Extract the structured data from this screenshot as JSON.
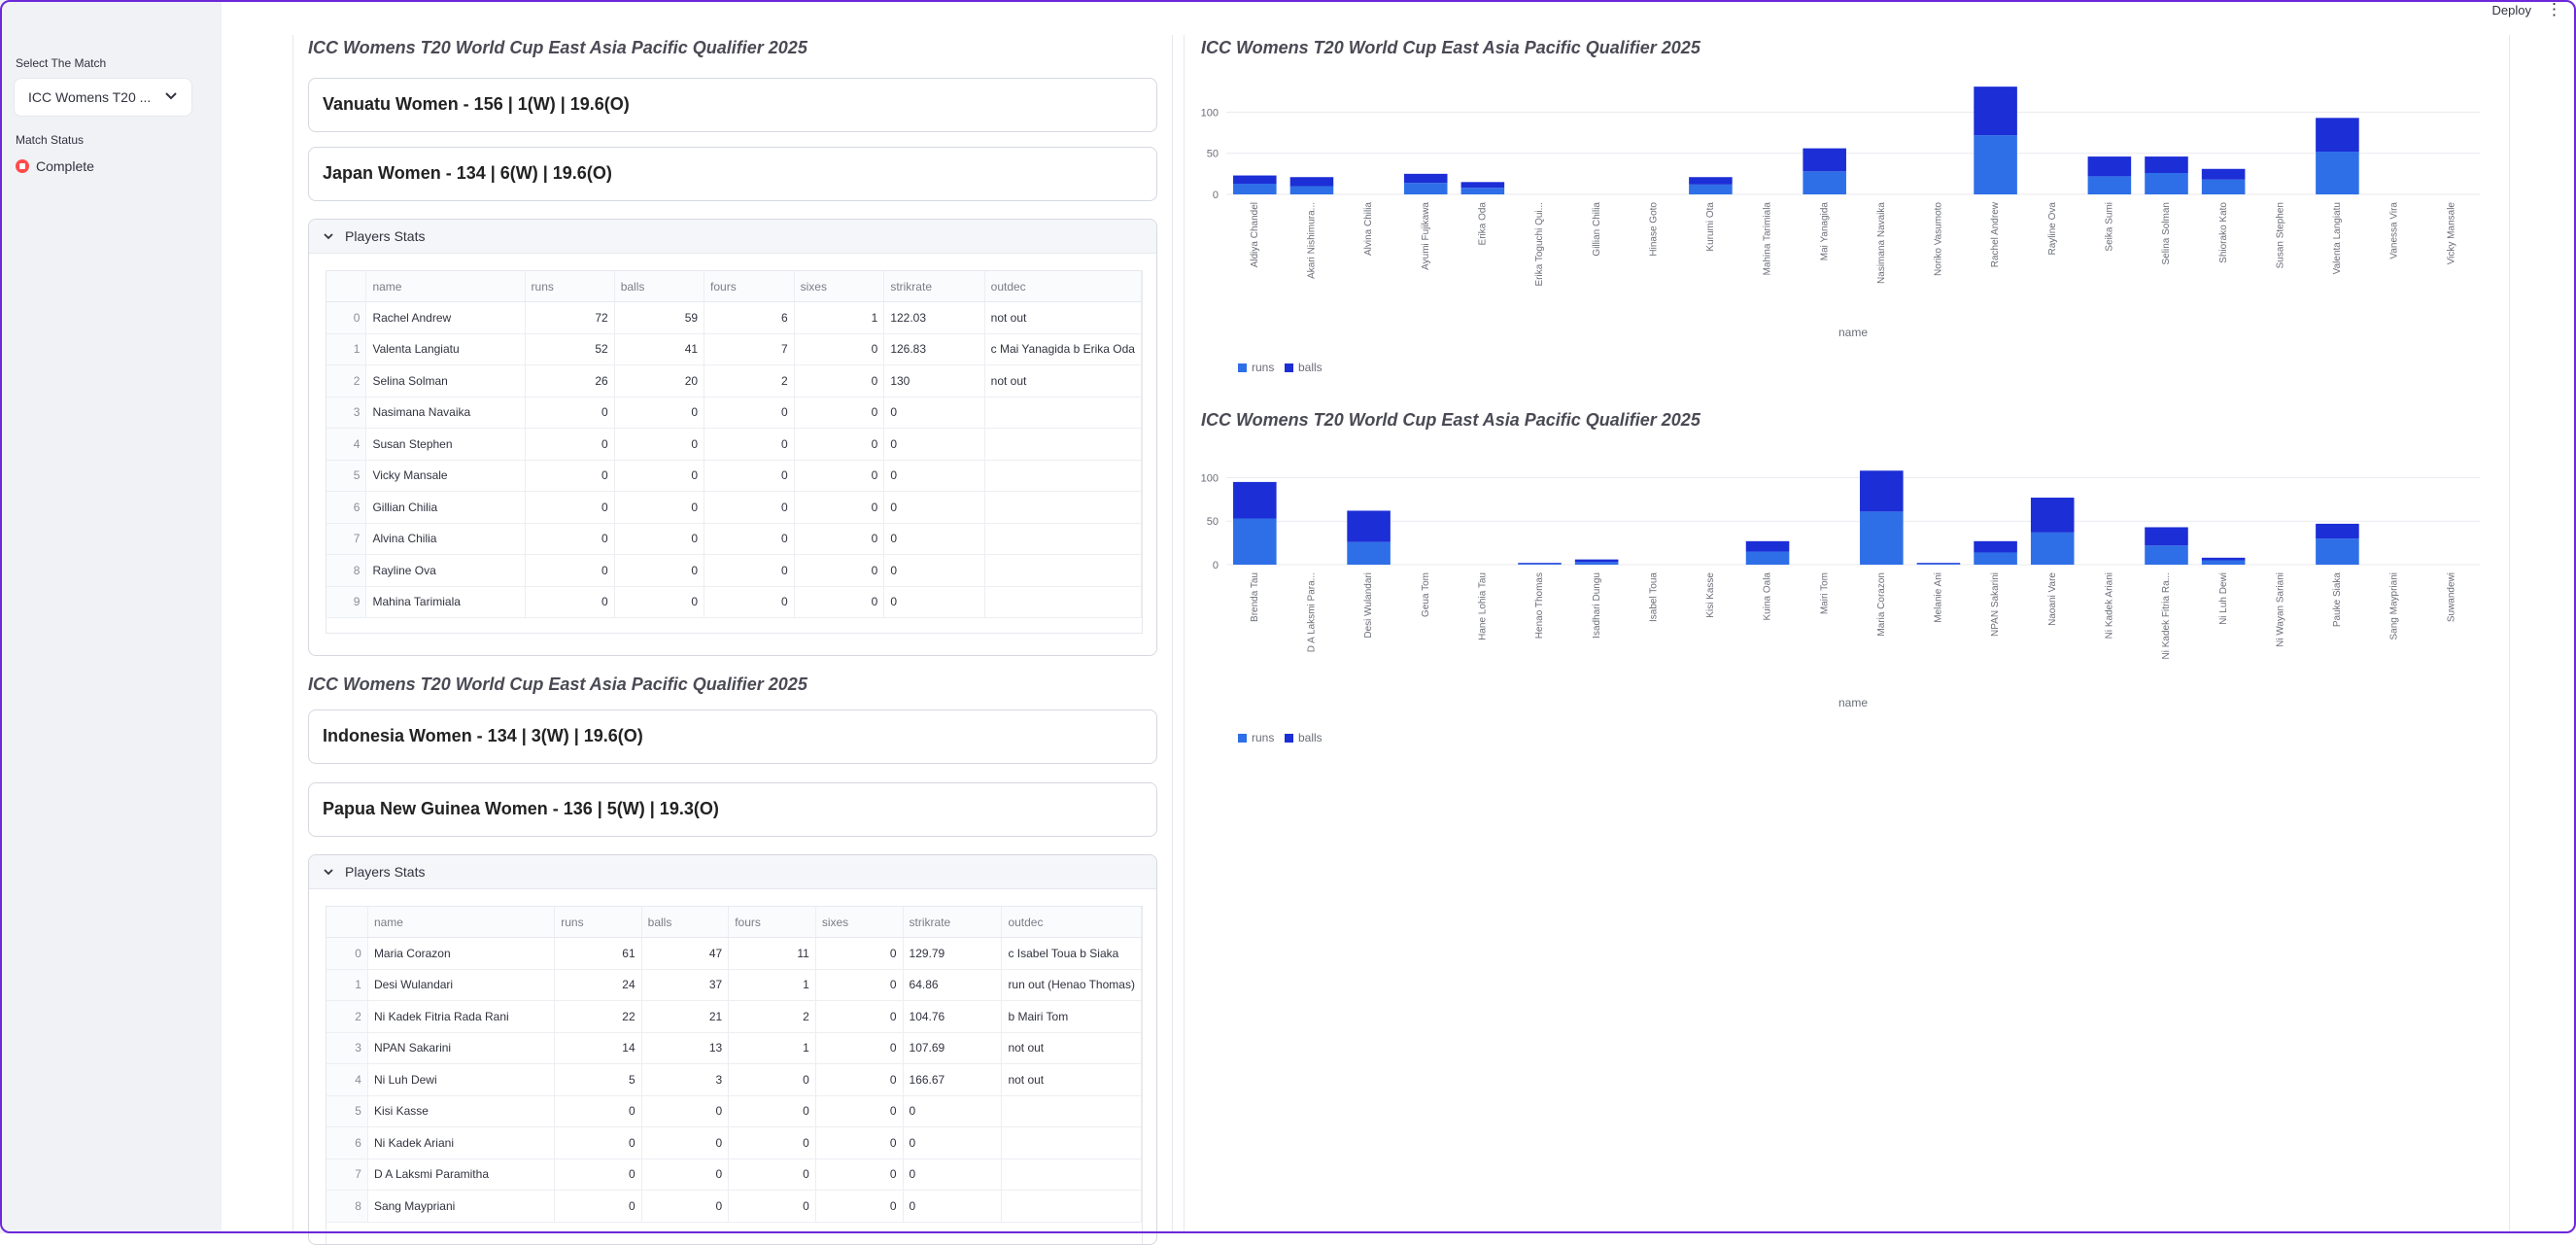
{
  "topbar": {
    "deploy_label": "Deploy",
    "menu_icon": "kebab-icon"
  },
  "sidebar": {
    "select_label": "Select The Match",
    "select_value": "ICC Womens T20 ...",
    "status_label": "Match Status",
    "status_value": "Complete"
  },
  "match1": {
    "title": "ICC Womens T20 World Cup East Asia Pacific Qualifier 2025",
    "team1": "Vanuatu Women - 156 | 1(W) | 19.6(O)",
    "team2": "Japan Women - 134 | 6(W) | 19.6(O)",
    "expander_label": "Players Stats",
    "columns": [
      "",
      "name",
      "runs",
      "balls",
      "fours",
      "sixes",
      "strikrate",
      "outdec"
    ],
    "rows": [
      [
        "0",
        "Rachel Andrew",
        "72",
        "59",
        "6",
        "1",
        "122.03",
        "not out"
      ],
      [
        "1",
        "Valenta Langiatu",
        "52",
        "41",
        "7",
        "0",
        "126.83",
        "c Mai Yanagida b Erika Oda"
      ],
      [
        "2",
        "Selina Solman",
        "26",
        "20",
        "2",
        "0",
        "130",
        "not out"
      ],
      [
        "3",
        "Nasimana Navaika",
        "0",
        "0",
        "0",
        "0",
        "0",
        ""
      ],
      [
        "4",
        "Susan Stephen",
        "0",
        "0",
        "0",
        "0",
        "0",
        ""
      ],
      [
        "5",
        "Vicky Mansale",
        "0",
        "0",
        "0",
        "0",
        "0",
        ""
      ],
      [
        "6",
        "Gillian Chilia",
        "0",
        "0",
        "0",
        "0",
        "0",
        ""
      ],
      [
        "7",
        "Alvina Chilia",
        "0",
        "0",
        "0",
        "0",
        "0",
        ""
      ],
      [
        "8",
        "Rayline Ova",
        "0",
        "0",
        "0",
        "0",
        "0",
        ""
      ],
      [
        "9",
        "Mahina Tarimiala",
        "0",
        "0",
        "0",
        "0",
        "0",
        ""
      ]
    ]
  },
  "match2": {
    "title": "ICC Womens T20 World Cup East Asia Pacific Qualifier 2025",
    "team1": "Indonesia Women - 134 | 3(W) | 19.6(O)",
    "team2": "Papua New Guinea Women - 136 | 5(W) | 19.3(O)",
    "expander_label": "Players Stats",
    "columns": [
      "",
      "name",
      "runs",
      "balls",
      "fours",
      "sixes",
      "strikrate",
      "outdec"
    ],
    "rows": [
      [
        "0",
        "Maria Corazon",
        "61",
        "47",
        "11",
        "0",
        "129.79",
        "c Isabel Toua b Siaka"
      ],
      [
        "1",
        "Desi Wulandari",
        "24",
        "37",
        "1",
        "0",
        "64.86",
        "run out (Henao Thomas)"
      ],
      [
        "2",
        "Ni Kadek Fitria Rada Rani",
        "22",
        "21",
        "2",
        "0",
        "104.76",
        "b Mairi Tom"
      ],
      [
        "3",
        "NPAN Sakarini",
        "14",
        "13",
        "1",
        "0",
        "107.69",
        "not out"
      ],
      [
        "4",
        "Ni Luh Dewi",
        "5",
        "3",
        "0",
        "0",
        "166.67",
        "not out"
      ],
      [
        "5",
        "Kisi Kasse",
        "0",
        "0",
        "0",
        "0",
        "0",
        ""
      ],
      [
        "6",
        "Ni Kadek Ariani",
        "0",
        "0",
        "0",
        "0",
        "0",
        ""
      ],
      [
        "7",
        "D A Laksmi Paramitha",
        "0",
        "0",
        "0",
        "0",
        "0",
        ""
      ],
      [
        "8",
        "Sang Maypriani",
        "0",
        "0",
        "0",
        "0",
        "0",
        ""
      ]
    ]
  },
  "chart_data": [
    {
      "type": "bar",
      "stacked": true,
      "title": "ICC Womens T20 World Cup East Asia Pacific Qualifier 2025",
      "xlabel": "name",
      "ylabel": "",
      "ylim": [
        0,
        130
      ],
      "yticks": [
        0,
        50,
        100
      ],
      "categories": [
        "Aldiya Chandel",
        "Akari Nishimura...",
        "Alvina Chilia",
        "Ayumi Fujikawa",
        "Erika Oda",
        "Erika Toguchi Qui...",
        "Gillian Chilia",
        "Hinase Goto",
        "Kurumi Ota",
        "Mahina Tarimiala",
        "Mai Yanagida",
        "Nasimana Navaika",
        "Noriko Vasumoto",
        "Rachel Andrew",
        "Rayline Ova",
        "Seika Sumi",
        "Selina Solman",
        "Shiorako Kato",
        "Susan Stephen",
        "Valenta Langiatu",
        "Vanessa Vira",
        "Vicky Mansale"
      ],
      "series": [
        {
          "name": "runs",
          "color": "#2e6fe8",
          "values": [
            13,
            10,
            0,
            14,
            8,
            0,
            0,
            0,
            12,
            0,
            28,
            0,
            0,
            72,
            0,
            22,
            26,
            18,
            0,
            52,
            0,
            0
          ]
        },
        {
          "name": "balls",
          "color": "#1c2ed6",
          "values": [
            10,
            11,
            0,
            11,
            7,
            0,
            0,
            0,
            9,
            0,
            28,
            0,
            0,
            59,
            0,
            24,
            20,
            13,
            0,
            41,
            0,
            0
          ]
        }
      ],
      "legend": "bottom-left"
    },
    {
      "type": "bar",
      "stacked": true,
      "title": "ICC Womens T20 World Cup East Asia Pacific Qualifier 2025",
      "xlabel": "name",
      "ylabel": "",
      "ylim": [
        0,
        115
      ],
      "yticks": [
        0,
        50,
        100
      ],
      "categories": [
        "Brenda Tau",
        "D A Laksmi Para...",
        "Desi Wulandari",
        "Geua Tom",
        "Hane Lohia Tau",
        "Henao Thomas",
        "Isadhari Dungu",
        "Isabel Toua",
        "Kisi Kasse",
        "Kuina Oala",
        "Mairi Tom",
        "Maria Corazon",
        "Melanie Ani",
        "NPAN Sakarini",
        "Naoani Vare",
        "Ni Kadek Ariani",
        "Ni Kadek Fitria Ra...",
        "Ni Luh Dewi",
        "Ni Wayan Sariani",
        "Pauke Siaka",
        "Sang Maypriani",
        "Suwandewi"
      ],
      "series": [
        {
          "name": "runs",
          "color": "#2e6fe8",
          "values": [
            53,
            0,
            26,
            0,
            0,
            1,
            3,
            0,
            0,
            15,
            0,
            61,
            1,
            14,
            37,
            0,
            22,
            5,
            0,
            30,
            0,
            0
          ]
        },
        {
          "name": "balls",
          "color": "#1c2ed6",
          "values": [
            42,
            0,
            36,
            0,
            0,
            1,
            3,
            0,
            0,
            12,
            0,
            47,
            1,
            13,
            40,
            0,
            21,
            3,
            0,
            17,
            0,
            0
          ]
        }
      ],
      "legend": "bottom-left"
    }
  ]
}
